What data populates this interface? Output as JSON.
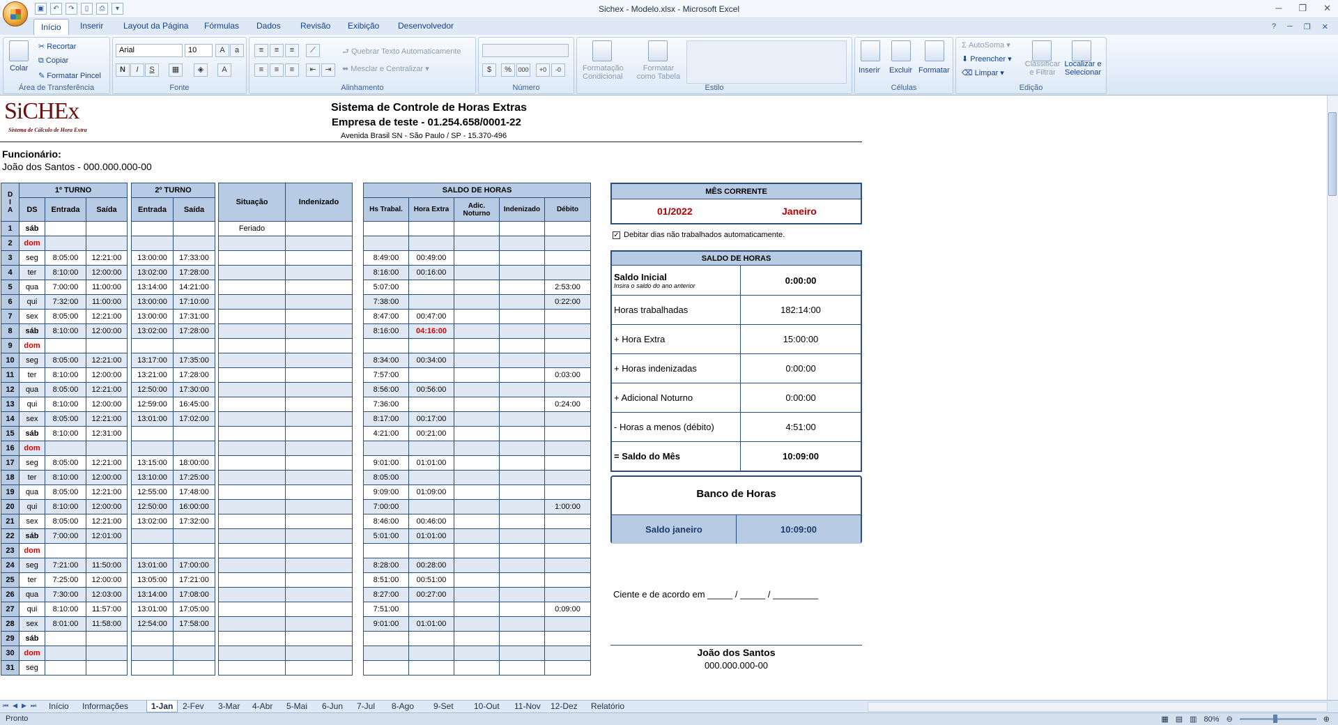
{
  "window": {
    "title": "Sichex - Modelo.xlsx - Microsoft Excel"
  },
  "ribbon_tabs": [
    "Início",
    "Inserir",
    "Layout da Página",
    "Fórmulas",
    "Dados",
    "Revisão",
    "Exibição",
    "Desenvolvedor"
  ],
  "ribbon": {
    "clipboard": {
      "paste": "Colar",
      "cut": "Recortar",
      "copy": "Copiar",
      "format_painter": "Formatar Pincel",
      "label": "Área de Transferência"
    },
    "font": {
      "name": "Arial",
      "size": "10",
      "label": "Fonte"
    },
    "alignment": {
      "wrap": "Quebrar Texto Automaticamente",
      "merge": "Mesclar e Centralizar",
      "label": "Alinhamento"
    },
    "number": {
      "label": "Número"
    },
    "style": {
      "cond1": "Formatação",
      "cond2": "Condicional",
      "table1": "Formatar",
      "table2": "como Tabela",
      "label": "Estilo"
    },
    "cells": {
      "insert": "Inserir",
      "delete": "Excluir",
      "format": "Formatar",
      "label": "Células"
    },
    "editing": {
      "autosum": "AutoSoma",
      "fill": "Preencher",
      "clear": "Limpar",
      "sort1": "Classificar",
      "sort2": "e Filtrar",
      "find1": "Localizar e",
      "find2": "Selecionar",
      "label": "Edição"
    }
  },
  "header": {
    "logo": "SiCHEx",
    "logo_sub": "Sistema de Cálculo de Hora Extra",
    "title": "Sistema de Controle de Horas Extras",
    "company": "Empresa de teste - 01.254.658/0001-22",
    "address": "Avenida Brasil SN - São Paulo / SP - 15.370-496",
    "employee_label": "Funcionário:",
    "employee": "João dos Santos - 000.000.000-00"
  },
  "table_headers": {
    "dia": "D I A",
    "turno1": "1º TURNO",
    "turno2": "2º TURNO",
    "ds": "DS",
    "entrada": "Entrada",
    "saida": "Saída",
    "situacao": "Situação",
    "indenizado": "Indenizado",
    "saldo": "SALDO DE HORAS",
    "hs_trabal": "Hs Trabal.",
    "hora_extra": "Hora Extra",
    "adic_noturno": "Adic. Noturno",
    "indenizado2": "Indenizado",
    "debito": "Débito"
  },
  "rows": [
    {
      "d": "1",
      "ds": "sáb",
      "e1": "",
      "s1": "",
      "e2": "",
      "s2": "",
      "sit": "Feriado",
      "ind": "",
      "hs": "",
      "he": "",
      "an": "",
      "ind2": "",
      "deb": ""
    },
    {
      "d": "2",
      "ds": "dom",
      "e1": "",
      "s1": "",
      "e2": "",
      "s2": "",
      "sit": "",
      "ind": "",
      "hs": "",
      "he": "",
      "an": "",
      "ind2": "",
      "deb": ""
    },
    {
      "d": "3",
      "ds": "seg",
      "e1": "8:05:00",
      "s1": "12:21:00",
      "e2": "13:00:00",
      "s2": "17:33:00",
      "sit": "",
      "ind": "",
      "hs": "8:49:00",
      "he": "00:49:00",
      "an": "",
      "ind2": "",
      "deb": ""
    },
    {
      "d": "4",
      "ds": "ter",
      "e1": "8:10:00",
      "s1": "12:00:00",
      "e2": "13:02:00",
      "s2": "17:28:00",
      "sit": "",
      "ind": "",
      "hs": "8:16:00",
      "he": "00:16:00",
      "an": "",
      "ind2": "",
      "deb": ""
    },
    {
      "d": "5",
      "ds": "qua",
      "e1": "7:00:00",
      "s1": "11:00:00",
      "e2": "13:14:00",
      "s2": "14:21:00",
      "sit": "",
      "ind": "",
      "hs": "5:07:00",
      "he": "",
      "an": "",
      "ind2": "",
      "deb": "2:53:00"
    },
    {
      "d": "6",
      "ds": "qui",
      "e1": "7:32:00",
      "s1": "11:00:00",
      "e2": "13:00:00",
      "s2": "17:10:00",
      "sit": "",
      "ind": "",
      "hs": "7:38:00",
      "he": "",
      "an": "",
      "ind2": "",
      "deb": "0:22:00"
    },
    {
      "d": "7",
      "ds": "sex",
      "e1": "8:05:00",
      "s1": "12:21:00",
      "e2": "13:00:00",
      "s2": "17:31:00",
      "sit": "",
      "ind": "",
      "hs": "8:47:00",
      "he": "00:47:00",
      "an": "",
      "ind2": "",
      "deb": ""
    },
    {
      "d": "8",
      "ds": "sáb",
      "e1": "8:10:00",
      "s1": "12:00:00",
      "e2": "13:02:00",
      "s2": "17:28:00",
      "sit": "",
      "ind": "",
      "hs": "8:16:00",
      "he": "04:16:00",
      "an": "",
      "ind2": "",
      "deb": ""
    },
    {
      "d": "9",
      "ds": "dom",
      "e1": "",
      "s1": "",
      "e2": "",
      "s2": "",
      "sit": "",
      "ind": "",
      "hs": "",
      "he": "",
      "an": "",
      "ind2": "",
      "deb": ""
    },
    {
      "d": "10",
      "ds": "seg",
      "e1": "8:05:00",
      "s1": "12:21:00",
      "e2": "13:17:00",
      "s2": "17:35:00",
      "sit": "",
      "ind": "",
      "hs": "8:34:00",
      "he": "00:34:00",
      "an": "",
      "ind2": "",
      "deb": ""
    },
    {
      "d": "11",
      "ds": "ter",
      "e1": "8:10:00",
      "s1": "12:00:00",
      "e2": "13:21:00",
      "s2": "17:28:00",
      "sit": "",
      "ind": "",
      "hs": "7:57:00",
      "he": "",
      "an": "",
      "ind2": "",
      "deb": "0:03:00"
    },
    {
      "d": "12",
      "ds": "qua",
      "e1": "8:05:00",
      "s1": "12:21:00",
      "e2": "12:50:00",
      "s2": "17:30:00",
      "sit": "",
      "ind": "",
      "hs": "8:56:00",
      "he": "00:56:00",
      "an": "",
      "ind2": "",
      "deb": ""
    },
    {
      "d": "13",
      "ds": "qui",
      "e1": "8:10:00",
      "s1": "12:00:00",
      "e2": "12:59:00",
      "s2": "16:45:00",
      "sit": "",
      "ind": "",
      "hs": "7:36:00",
      "he": "",
      "an": "",
      "ind2": "",
      "deb": "0:24:00"
    },
    {
      "d": "14",
      "ds": "sex",
      "e1": "8:05:00",
      "s1": "12:21:00",
      "e2": "13:01:00",
      "s2": "17:02:00",
      "sit": "",
      "ind": "",
      "hs": "8:17:00",
      "he": "00:17:00",
      "an": "",
      "ind2": "",
      "deb": ""
    },
    {
      "d": "15",
      "ds": "sáb",
      "e1": "8:10:00",
      "s1": "12:31:00",
      "e2": "",
      "s2": "",
      "sit": "",
      "ind": "",
      "hs": "4:21:00",
      "he": "00:21:00",
      "an": "",
      "ind2": "",
      "deb": ""
    },
    {
      "d": "16",
      "ds": "dom",
      "e1": "",
      "s1": "",
      "e2": "",
      "s2": "",
      "sit": "",
      "ind": "",
      "hs": "",
      "he": "",
      "an": "",
      "ind2": "",
      "deb": ""
    },
    {
      "d": "17",
      "ds": "seg",
      "e1": "8:05:00",
      "s1": "12:21:00",
      "e2": "13:15:00",
      "s2": "18:00:00",
      "sit": "",
      "ind": "",
      "hs": "9:01:00",
      "he": "01:01:00",
      "an": "",
      "ind2": "",
      "deb": ""
    },
    {
      "d": "18",
      "ds": "ter",
      "e1": "8:10:00",
      "s1": "12:00:00",
      "e2": "13:10:00",
      "s2": "17:25:00",
      "sit": "",
      "ind": "",
      "hs": "8:05:00",
      "he": "",
      "an": "",
      "ind2": "",
      "deb": ""
    },
    {
      "d": "19",
      "ds": "qua",
      "e1": "8:05:00",
      "s1": "12:21:00",
      "e2": "12:55:00",
      "s2": "17:48:00",
      "sit": "",
      "ind": "",
      "hs": "9:09:00",
      "he": "01:09:00",
      "an": "",
      "ind2": "",
      "deb": ""
    },
    {
      "d": "20",
      "ds": "qui",
      "e1": "8:10:00",
      "s1": "12:00:00",
      "e2": "12:50:00",
      "s2": "16:00:00",
      "sit": "",
      "ind": "",
      "hs": "7:00:00",
      "he": "",
      "an": "",
      "ind2": "",
      "deb": "1:00:00"
    },
    {
      "d": "21",
      "ds": "sex",
      "e1": "8:05:00",
      "s1": "12:21:00",
      "e2": "13:02:00",
      "s2": "17:32:00",
      "sit": "",
      "ind": "",
      "hs": "8:46:00",
      "he": "00:46:00",
      "an": "",
      "ind2": "",
      "deb": ""
    },
    {
      "d": "22",
      "ds": "sáb",
      "e1": "7:00:00",
      "s1": "12:01:00",
      "e2": "",
      "s2": "",
      "sit": "",
      "ind": "",
      "hs": "5:01:00",
      "he": "01:01:00",
      "an": "",
      "ind2": "",
      "deb": ""
    },
    {
      "d": "23",
      "ds": "dom",
      "e1": "",
      "s1": "",
      "e2": "",
      "s2": "",
      "sit": "",
      "ind": "",
      "hs": "",
      "he": "",
      "an": "",
      "ind2": "",
      "deb": ""
    },
    {
      "d": "24",
      "ds": "seg",
      "e1": "7:21:00",
      "s1": "11:50:00",
      "e2": "13:01:00",
      "s2": "17:00:00",
      "sit": "",
      "ind": "",
      "hs": "8:28:00",
      "he": "00:28:00",
      "an": "",
      "ind2": "",
      "deb": ""
    },
    {
      "d": "25",
      "ds": "ter",
      "e1": "7:25:00",
      "s1": "12:00:00",
      "e2": "13:05:00",
      "s2": "17:21:00",
      "sit": "",
      "ind": "",
      "hs": "8:51:00",
      "he": "00:51:00",
      "an": "",
      "ind2": "",
      "deb": ""
    },
    {
      "d": "26",
      "ds": "qua",
      "e1": "7:30:00",
      "s1": "12:03:00",
      "e2": "13:14:00",
      "s2": "17:08:00",
      "sit": "",
      "ind": "",
      "hs": "8:27:00",
      "he": "00:27:00",
      "an": "",
      "ind2": "",
      "deb": ""
    },
    {
      "d": "27",
      "ds": "qui",
      "e1": "8:10:00",
      "s1": "11:57:00",
      "e2": "13:01:00",
      "s2": "17:05:00",
      "sit": "",
      "ind": "",
      "hs": "7:51:00",
      "he": "",
      "an": "",
      "ind2": "",
      "deb": "0:09:00"
    },
    {
      "d": "28",
      "ds": "sex",
      "e1": "8:01:00",
      "s1": "11:58:00",
      "e2": "12:54:00",
      "s2": "17:58:00",
      "sit": "",
      "ind": "",
      "hs": "9:01:00",
      "he": "01:01:00",
      "an": "",
      "ind2": "",
      "deb": ""
    },
    {
      "d": "29",
      "ds": "sáb",
      "e1": "",
      "s1": "",
      "e2": "",
      "s2": "",
      "sit": "",
      "ind": "",
      "hs": "",
      "he": "",
      "an": "",
      "ind2": "",
      "deb": ""
    },
    {
      "d": "30",
      "ds": "dom",
      "e1": "",
      "s1": "",
      "e2": "",
      "s2": "",
      "sit": "",
      "ind": "",
      "hs": "",
      "he": "",
      "an": "",
      "ind2": "",
      "deb": ""
    },
    {
      "d": "31",
      "ds": "seg",
      "e1": "",
      "s1": "",
      "e2": "",
      "s2": "",
      "sit": "",
      "ind": "",
      "hs": "",
      "he": "",
      "an": "",
      "ind2": "",
      "deb": ""
    }
  ],
  "mes_corrente": {
    "label": "MÊS CORRENTE",
    "date": "01/2022",
    "month": "Janeiro"
  },
  "debitar": "Debitar dias não trabalhados automaticamente.",
  "saldo_panel": {
    "title": "SALDO DE HORAS",
    "saldo_inicial": "Saldo Inicial",
    "saldo_inicial_hint": "Insira o saldo do ano anterior",
    "saldo_inicial_val": "0:00:00",
    "horas_trab": "Horas trabalhadas",
    "horas_trab_val": "182:14:00",
    "hora_extra": "+ Hora Extra",
    "hora_extra_val": "15:00:00",
    "horas_ind": "+ Horas indenizadas",
    "horas_ind_val": "0:00:00",
    "adic_not": "+ Adicional Noturno",
    "adic_not_val": "0:00:00",
    "horas_menos": "- Horas a menos (débito)",
    "horas_menos_val": "4:51:00",
    "saldo_mes": "= Saldo do Mês",
    "saldo_mes_val": "10:09:00"
  },
  "banco": {
    "title": "Banco de Horas",
    "label": "Saldo janeiro",
    "value": "10:09:00"
  },
  "ciente": "Ciente e de acordo em  _____ / _____ / _________",
  "signature": {
    "name": "João dos Santos",
    "cpf": "000.000.000-00"
  },
  "sheet_tabs": [
    "Início",
    "Informações",
    "1-Jan",
    "2-Fev",
    "3-Mar",
    "4-Abr",
    "5-Mai",
    "6-Jun",
    "7-Jul",
    "8-Ago",
    "9-Set",
    "10-Out",
    "11-Nov",
    "12-Dez",
    "Relatório"
  ],
  "status": {
    "ready": "Pronto",
    "zoom": "80%"
  }
}
